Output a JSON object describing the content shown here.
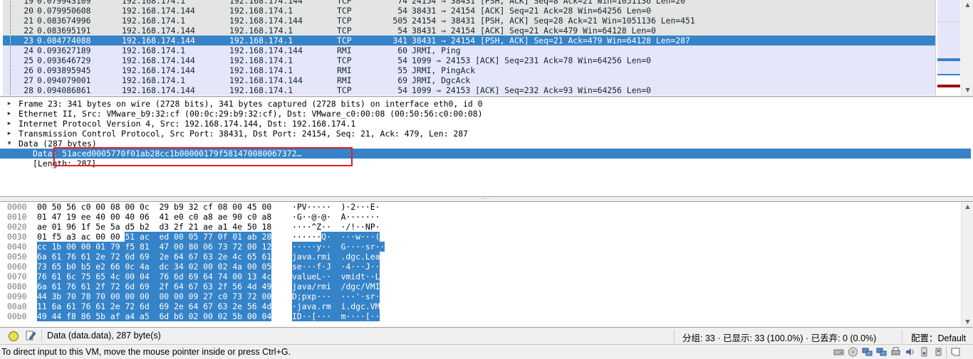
{
  "packet_list": {
    "rows": [
      {
        "no": "19",
        "time": "0.079943109",
        "src": "192.168.174.1",
        "dst": "192.168.174.144",
        "proto": "TCP",
        "len": "74",
        "info": "24154 → 38431 [PSH, ACK] Seq=8 Ack=21 Win=1051136 Len=20",
        "style": "gray"
      },
      {
        "no": "20",
        "time": "0.079950608",
        "src": "192.168.174.144",
        "dst": "192.168.174.1",
        "proto": "TCP",
        "len": "54",
        "info": "38431 → 24154 [ACK] Seq=21 Ack=28 Win=64256 Len=0",
        "style": "gray"
      },
      {
        "no": "21",
        "time": "0.083674996",
        "src": "192.168.174.1",
        "dst": "192.168.174.144",
        "proto": "TCP",
        "len": "505",
        "info": "24154 → 38431 [PSH, ACK] Seq=28 Ack=21 Win=1051136 Len=451",
        "style": "gray"
      },
      {
        "no": "22",
        "time": "0.083695191",
        "src": "192.168.174.144",
        "dst": "192.168.174.1",
        "proto": "TCP",
        "len": "54",
        "info": "38431 → 24154 [ACK] Seq=21 Ack=479 Win=64128 Len=0",
        "style": "gray"
      },
      {
        "no": "23",
        "time": "0.084774088",
        "src": "192.168.174.144",
        "dst": "192.168.174.1",
        "proto": "TCP",
        "len": "341",
        "info": "38431 → 24154 [PSH, ACK] Seq=21 Ack=479 Win=64128 Len=287",
        "style": "sel"
      },
      {
        "no": "24",
        "time": "0.093627189",
        "src": "192.168.174.1",
        "dst": "192.168.174.144",
        "proto": "RMI",
        "len": "60",
        "info": "JRMI, Ping",
        "style": "lav"
      },
      {
        "no": "25",
        "time": "0.093646729",
        "src": "192.168.174.144",
        "dst": "192.168.174.1",
        "proto": "TCP",
        "len": "54",
        "info": "1099 → 24153 [ACK] Seq=231 Ack=78 Win=64256 Len=0",
        "style": "lav"
      },
      {
        "no": "26",
        "time": "0.093895945",
        "src": "192.168.174.144",
        "dst": "192.168.174.1",
        "proto": "RMI",
        "len": "55",
        "info": "JRMI, PingAck",
        "style": "lav"
      },
      {
        "no": "27",
        "time": "0.094079001",
        "src": "192.168.174.1",
        "dst": "192.168.174.144",
        "proto": "RMI",
        "len": "69",
        "info": "JRMI, DgcAck",
        "style": "lav"
      },
      {
        "no": "28",
        "time": "0.094086861",
        "src": "192.168.174.144",
        "dst": "192.168.174.1",
        "proto": "TCP",
        "len": "54",
        "info": "1099 → 24153 [ACK] Seq=232 Ack=93 Win=64256 Len=0",
        "style": "lav"
      }
    ]
  },
  "details": {
    "rows": [
      {
        "indent": 0,
        "twisty": "collapsed",
        "text": "Frame 23: 341 bytes on wire (2728 bits), 341 bytes captured (2728 bits) on interface eth0, id 0"
      },
      {
        "indent": 0,
        "twisty": "collapsed",
        "text": "Ethernet II, Src: VMware_b9:32:cf (00:0c:29:b9:32:cf), Dst: VMware_c0:00:08 (00:50:56:c0:00:08)"
      },
      {
        "indent": 0,
        "twisty": "collapsed",
        "text": "Internet Protocol Version 4, Src: 192.168.174.144, Dst: 192.168.174.1"
      },
      {
        "indent": 0,
        "twisty": "collapsed",
        "text": "Transmission Control Protocol, Src Port: 38431, Dst Port: 24154, Seq: 21, Ack: 479, Len: 287"
      },
      {
        "indent": 0,
        "twisty": "expanded",
        "text": "Data (287 bytes)"
      },
      {
        "indent": 1,
        "twisty": "none",
        "text": "Data: 51aced0005770f01ab28cc1b00000179f581470080067372…",
        "selected": true
      },
      {
        "indent": 1,
        "twisty": "none",
        "text": "[Length: 287]"
      }
    ]
  },
  "bytes": {
    "rows": [
      {
        "offset": "0000",
        "hex_pre": "00 50 56 c0 00 08 00 0c  29 b9 32 cf 08 00 45 00",
        "hex_hl": "",
        "hex_post": "",
        "ascii_pre": "·PV·····  )·2···E·",
        "ascii_hl": "",
        "ascii_post": ""
      },
      {
        "offset": "0010",
        "hex_pre": "01 47 19 ee 40 00 40 06  41 e0 c0 a8 ae 90 c0 a8",
        "hex_hl": "",
        "hex_post": "",
        "ascii_pre": "·G··@·@·  A·······",
        "ascii_hl": "",
        "ascii_post": ""
      },
      {
        "offset": "0020",
        "hex_pre": "ae 01 96 1f 5e 5a d5 b2  d3 2f 21 ae a1 4e 50 18",
        "hex_hl": "",
        "hex_post": "",
        "ascii_pre": "····^Z··  ·/!··NP·",
        "ascii_hl": "",
        "ascii_post": ""
      },
      {
        "offset": "0030",
        "hex_pre": "01 f5 a3 ac 00 00 ",
        "hex_hl": "51 ac  ed 00 05 77 0f 01 ab 28",
        "hex_post": "",
        "ascii_pre": "······",
        "ascii_hl": "Q·  ···w···(",
        "ascii_post": ""
      },
      {
        "offset": "0040",
        "hex_pre": "",
        "hex_hl": "cc 1b 00 00 01 79 f5 81  47 00 80 06 73 72 00 12",
        "hex_post": "",
        "ascii_pre": "",
        "ascii_hl": "·····y··  G····sr··",
        "ascii_post": ""
      },
      {
        "offset": "0050",
        "hex_pre": "",
        "hex_hl": "6a 61 76 61 2e 72 6d 69  2e 64 67 63 2e 4c 65 61",
        "hex_post": "",
        "ascii_pre": "",
        "ascii_hl": "java.rmi  .dgc.Lea",
        "ascii_post": ""
      },
      {
        "offset": "0060",
        "hex_pre": "",
        "hex_hl": "73 65 b0 b5 e2 66 0c 4a  dc 34 02 00 02 4a 00 05",
        "hex_post": "",
        "ascii_pre": "",
        "ascii_hl": "se···f·J  ·4···J··",
        "ascii_post": ""
      },
      {
        "offset": "0070",
        "hex_pre": "",
        "hex_hl": "76 61 6c 75 65 4c 00 04  76 6d 69 64 74 00 13 4c",
        "hex_post": "",
        "ascii_pre": "",
        "ascii_hl": "valueL··  vmidt··L",
        "ascii_post": ""
      },
      {
        "offset": "0080",
        "hex_pre": "",
        "hex_hl": "6a 61 76 61 2f 72 6d 69  2f 64 67 63 2f 56 4d 49",
        "hex_post": "",
        "ascii_pre": "",
        "ascii_hl": "java/rmi  /dgc/VMI",
        "ascii_post": ""
      },
      {
        "offset": "0090",
        "hex_pre": "",
        "hex_hl": "44 3b 70 78 70 00 00 00  00 00 09 27 c0 73 72 00",
        "hex_post": "",
        "ascii_pre": "",
        "ascii_hl": "D;pxp···  ···'·sr·",
        "ascii_post": ""
      },
      {
        "offset": "00a0",
        "hex_pre": "",
        "hex_hl": "11 6a 61 76 61 2e 72 6d  69 2e 64 67 63 2e 56 4d",
        "hex_post": "",
        "ascii_pre": "",
        "ascii_hl": "·java.rm  i.dgc.VM",
        "ascii_post": ""
      },
      {
        "offset": "00b0",
        "hex_pre": "",
        "hex_hl": "49 44 f8 86 5b af a4 a5  6d b6 02 00 02 5b 00 04",
        "hex_post": "",
        "ascii_pre": "",
        "ascii_hl": "ID··[···  m····[··",
        "ascii_post": ""
      }
    ]
  },
  "statusbar": {
    "field_info": "Data (data.data), 287 byte(s)",
    "stats": "分组: 33 · 已显示: 33 (100.0%) · 已丢弃: 0 (0.0%)",
    "profile": "配置：Default",
    "led_icon": "expert-info-led-icon",
    "edit_icon": "capture-comment-icon"
  },
  "vmbar": {
    "text": "To direct input to this VM, move the mouse pointer inside or press Ctrl+G."
  },
  "colors": {
    "selection": "#3583c8",
    "row_lavender": "#e6e6fa",
    "row_gray": "#e4e4e4",
    "annotation_box": "#e02020"
  }
}
